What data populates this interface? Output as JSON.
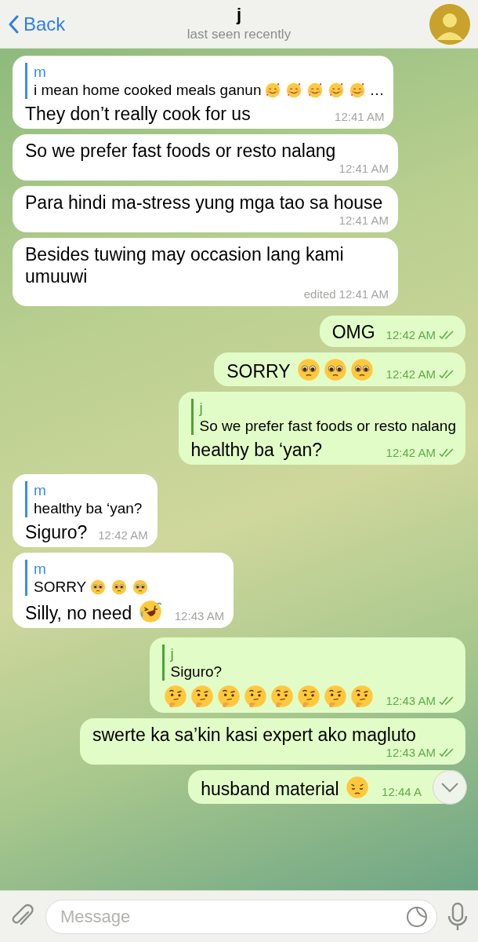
{
  "header": {
    "back": "Back",
    "title": "j",
    "subtitle": "last seen recently"
  },
  "messages": [
    {
      "kind": "incoming",
      "reply": {
        "name": "m",
        "text": "i mean home cooked meals ganun",
        "emojis": [
          {
            "kind": "smiling-hearts"
          },
          {
            "kind": "smiling-hearts"
          },
          {
            "kind": "smiling-hearts"
          },
          {
            "kind": "smiling-hearts"
          },
          {
            "kind": "smiling-hearts"
          }
        ],
        "tail": "…"
      },
      "text": "They don’t really cook for us",
      "time": "12:41 AM"
    },
    {
      "kind": "incoming",
      "text": "So we prefer fast foods or resto nalang",
      "time": "12:41 AM"
    },
    {
      "kind": "incoming",
      "text": "Para hindi ma-stress yung mga tao sa house",
      "time": "12:41 AM"
    },
    {
      "kind": "incoming",
      "text": "Besides tuwing may occasion lang kami umuuwi",
      "edited": "edited",
      "time": "12:41 AM"
    },
    {
      "kind": "outgoing",
      "text": "OMG",
      "time": "12:42 AM",
      "read": true
    },
    {
      "kind": "outgoing",
      "text": "SORRY",
      "emojis": [
        {
          "kind": "pleading"
        },
        {
          "kind": "pleading"
        },
        {
          "kind": "pleading"
        }
      ],
      "time": "12:42 AM",
      "read": true
    },
    {
      "kind": "outgoing",
      "reply": {
        "name": "j",
        "text": "So we prefer fast foods or resto nalang"
      },
      "text": "healthy ba ‘yan?",
      "time": "12:42 AM",
      "read": true
    },
    {
      "kind": "incoming",
      "reply": {
        "name": "m",
        "text": "healthy ba ‘yan?"
      },
      "text": "Siguro?",
      "time": "12:42 AM"
    },
    {
      "kind": "incoming",
      "reply": {
        "name": "m",
        "text": "SORRY",
        "emojis": [
          {
            "kind": "pleading"
          },
          {
            "kind": "pleading"
          },
          {
            "kind": "pleading"
          }
        ]
      },
      "text": "Silly, no need",
      "emojis": [
        {
          "kind": "rofl"
        }
      ],
      "time": "12:43 AM"
    },
    {
      "kind": "outgoing",
      "reply": {
        "name": "j",
        "text": "Siguro?"
      },
      "emojis": [
        {
          "kind": "thinking"
        },
        {
          "kind": "thinking"
        },
        {
          "kind": "thinking"
        },
        {
          "kind": "thinking"
        },
        {
          "kind": "thinking"
        },
        {
          "kind": "thinking"
        },
        {
          "kind": "thinking"
        },
        {
          "kind": "thinking"
        }
      ],
      "time": "12:43 AM",
      "read": true
    },
    {
      "kind": "outgoing",
      "text": "swerte ka sa’kin kasi expert ako magluto",
      "time": "12:43 AM",
      "read": true
    },
    {
      "kind": "outgoing",
      "text": "husband material",
      "emojis": [
        {
          "kind": "pensive"
        }
      ],
      "time": "12:44 A"
    }
  ],
  "composer": {
    "placeholder": "Message"
  }
}
